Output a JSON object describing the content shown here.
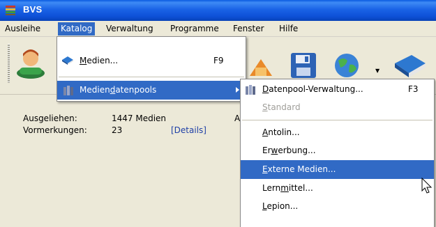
{
  "window": {
    "title": "BVS"
  },
  "menubar": {
    "items": [
      "Ausleihe",
      "Katalog",
      "Verwaltung",
      "Programme",
      "Fenster",
      "Hilfe"
    ]
  },
  "katalog_menu": {
    "items": [
      {
        "label_pre": "",
        "label_u": "M",
        "label_post": "edien...",
        "shortcut": "F9"
      },
      {
        "label_pre": "Medien",
        "label_u": "d",
        "label_post": "atenpools",
        "shortcut": ""
      }
    ]
  },
  "submenu": {
    "items": [
      {
        "pre": "",
        "u": "D",
        "post": "atenpool-Verwaltung...",
        "shortcut": "F3",
        "disabled": false
      },
      {
        "pre": "",
        "u": "S",
        "post": "tandard",
        "shortcut": "",
        "disabled": true
      },
      {
        "pre": "",
        "u": "A",
        "post": "ntolin...",
        "shortcut": "",
        "disabled": false
      },
      {
        "pre": "Er",
        "u": "w",
        "post": "erbung...",
        "shortcut": "",
        "disabled": false
      },
      {
        "pre": "",
        "u": "E",
        "post": "xterne Medien...",
        "shortcut": "",
        "disabled": false
      },
      {
        "pre": "Lern",
        "u": "m",
        "post": "ittel...",
        "shortcut": "",
        "disabled": false
      },
      {
        "pre": "",
        "u": "L",
        "post": "epion...",
        "shortcut": "",
        "disabled": false
      }
    ]
  },
  "stats": {
    "ausgeliehen_label": "Ausgeliehen:",
    "ausgeliehen_value": "1447 Medien",
    "cut_letter": "A",
    "vormerkungen_label": "Vormerkungen:",
    "vormerkungen_value": "23",
    "details_link": "[Details]"
  },
  "colors": {
    "highlight": "#316ac5",
    "title_bar": "#0a5be0"
  }
}
